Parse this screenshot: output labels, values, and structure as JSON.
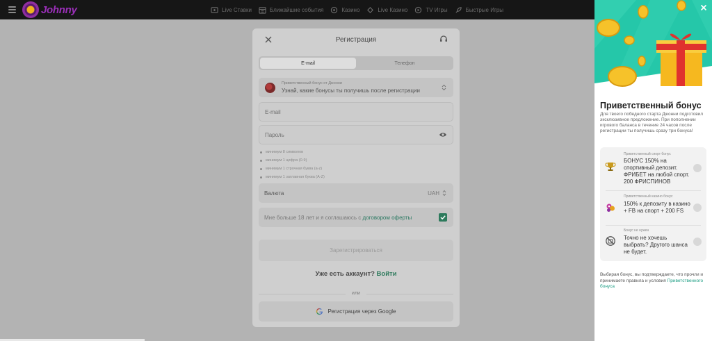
{
  "header": {
    "logo_text": "Johnny",
    "nav": [
      {
        "label": "Live Ставки",
        "icon": "live-tv-icon"
      },
      {
        "label": "Ближайшие события",
        "icon": "calendar-icon"
      },
      {
        "label": "Казино",
        "icon": "casino-icon"
      },
      {
        "label": "Live Казино",
        "icon": "cards-icon"
      },
      {
        "label": "TV Игры",
        "icon": "tv-games-icon"
      },
      {
        "label": "Быстрые Игры",
        "icon": "rocket-icon"
      }
    ]
  },
  "modal": {
    "title": "Регистрация",
    "tabs": [
      "E-mail",
      "Телефон"
    ],
    "active_tab": "E-mail",
    "bonus_select": {
      "caption": "Приветственный бонус от Джонни",
      "text": "Узнай, какие бонусы ты получишь после регистрации"
    },
    "email_placeholder": "E-mail",
    "password_placeholder": "Пароль",
    "password_rules": [
      "минимум 8 символов",
      "минимум 1 цифра (0-9)",
      "минимум 1 строчная буква (a-z)",
      "минимум 1 заглавная буква (A-Z)"
    ],
    "currency": {
      "label": "Валюта",
      "value": "UAH"
    },
    "agree": {
      "text": "Мне больше 18 лет и я соглашаюсь с ",
      "link": "договором оферты",
      "checked": true
    },
    "register_button": "Зарегистрироваться",
    "have_account": {
      "text": "Уже есть аккаунт? ",
      "link": "Войти"
    },
    "or_text": "или",
    "google_button": "Регистрация через Google"
  },
  "bonus_panel": {
    "title": "Приветственный бонус",
    "description": "Для твоего победного старта Джонни подготовил эксклюзивное предложение. При пополнении игрового баланса в течение 24 часов после регистрации ты получишь сразу три бонуса!",
    "options": [
      {
        "caption": "Приветственный спорт бонус",
        "text": "БОНУС 150% на спортивный депозит. ФРИБЕТ на любой спорт. 200 ФРИСПИНОВ",
        "icon": "trophy-icon"
      },
      {
        "caption": "Приветственный казино бонус",
        "text": "150% к депозиту в казино + FB на спорт + 200 FS",
        "icon": "casino-chips-icon"
      },
      {
        "caption": "Бонус не нужен",
        "text": "Точно не хочешь выбрать? Другого шанса не будет.",
        "icon": "no-bonus-icon"
      }
    ],
    "footer": {
      "text": "Выбирая бонус, вы подтверждаете, что прочли и принимаете правила и условия ",
      "link": "Приветственного бонуса"
    }
  },
  "colors": {
    "accent_green": "#2d7a5c",
    "banner_teal": "#25c7a9",
    "brand_purple": "#9a2fb8"
  }
}
